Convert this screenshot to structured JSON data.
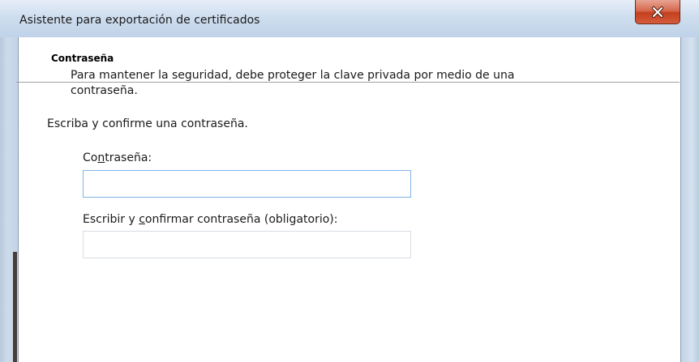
{
  "window": {
    "title": "Asistente para exportación de certificados",
    "close_glyph": "X"
  },
  "header": {
    "title": "Contraseña",
    "description": "Para mantener la seguridad, debe proteger la clave privada por medio de una contraseña."
  },
  "form": {
    "instruction": "Escriba y confirme una contraseña.",
    "password": {
      "label_pre": "Co",
      "label_key": "n",
      "label_post": "traseña:",
      "value": "",
      "placeholder": ""
    },
    "confirm": {
      "label_pre": "Escribir y ",
      "label_key": "c",
      "label_post": "onfirmar contraseña (obligatorio):",
      "value": "",
      "placeholder": ""
    }
  },
  "colors": {
    "focused_border": "#7eb4ea",
    "close_button": "#c3401d"
  },
  "icons": [
    "close-icon"
  ]
}
